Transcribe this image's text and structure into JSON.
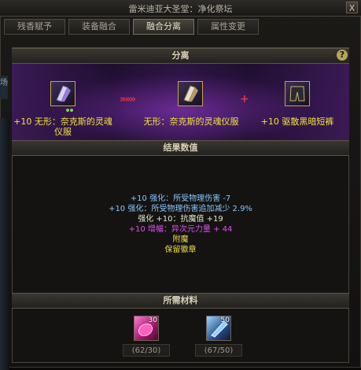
{
  "window": {
    "title": "雷米迪亚大圣堂：净化祭坛",
    "close_glyph": "X"
  },
  "tabs": [
    {
      "label": "残香赋予",
      "active": false
    },
    {
      "label": "装备融合",
      "active": false
    },
    {
      "label": "融合分离",
      "active": true
    },
    {
      "label": "属性变更",
      "active": false
    }
  ],
  "side_text": "场",
  "separate": {
    "header": "分离",
    "help_glyph": "?",
    "left_item": {
      "label": "+10 无形：奈克斯的灵魂仪服",
      "icon": "soul-robe-icon"
    },
    "middle_item": {
      "label": "无形：奈克斯的灵魂仪服",
      "icon": "soul-robe-icon"
    },
    "right_item": {
      "label": "+10 驱散黑暗短裤",
      "icon": "dark-shorts-icon"
    },
    "arrows": "»»»",
    "plus": "+"
  },
  "results": {
    "header": "结果数值",
    "lines": [
      {
        "text": "+10 强化：所受物理伤害 -7",
        "color": "blue"
      },
      {
        "text": "+10 强化：所受物理伤害追加减少 2.9%",
        "color": "blue"
      },
      {
        "text": "强化 +10：抗魔值 +19",
        "color": "white"
      },
      {
        "text": "+10 增幅：异次元力量 + 44",
        "color": "pink"
      },
      {
        "text": "附魔",
        "color": "yellow"
      },
      {
        "text": "保留徽章",
        "color": "yellow"
      }
    ]
  },
  "materials": {
    "header": "所需材料",
    "items": [
      {
        "icon": "pink-crystal-icon",
        "badge": "30",
        "owned": "(62/30)"
      },
      {
        "icon": "blue-crystal-icon",
        "badge": "50",
        "owned": "(67/50)"
      }
    ]
  }
}
